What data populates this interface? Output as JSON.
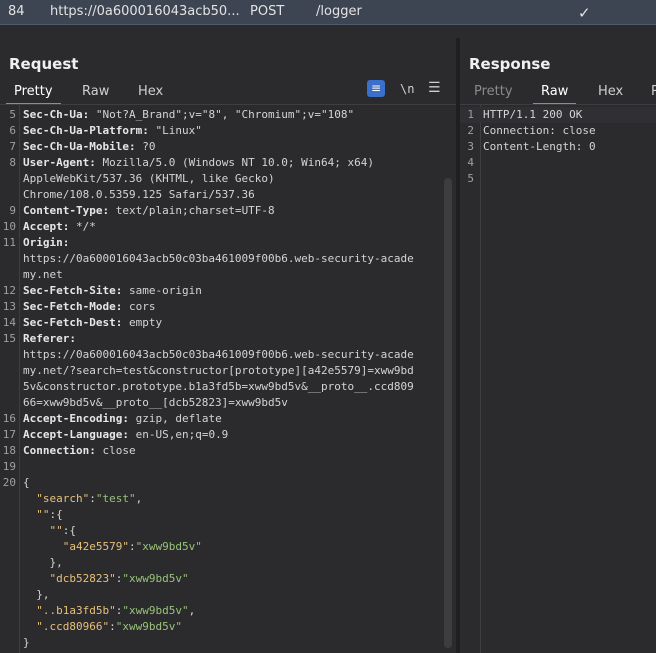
{
  "history": {
    "id": "84",
    "url": "https://0a600016043acb50...",
    "method": "POST",
    "path": "/logger",
    "status_check": "✓"
  },
  "request": {
    "title": "Request",
    "tabs": [
      "Pretty",
      "Raw",
      "Hex"
    ],
    "active_tab": "Pretty",
    "tools": {
      "wrap_icon": "wrap-lines-icon",
      "newline_label": "\\n",
      "menu_icon": "hamburger-menu-icon"
    },
    "lines": [
      {
        "n": "5",
        "name": "Sec-Ch-Ua",
        "value": "\"Not?A_Brand\";v=\"8\", \"Chromium\";v=\"108\""
      },
      {
        "n": "6",
        "name": "Sec-Ch-Ua-Platform",
        "value": "\"Linux\""
      },
      {
        "n": "7",
        "name": "Sec-Ch-Ua-Mobile",
        "value": "?0"
      },
      {
        "n": "8",
        "name": "User-Agent",
        "value": "Mozilla/5.0 (Windows NT 10.0; Win64; x64)"
      },
      {
        "n": "",
        "name": "",
        "value": "AppleWebKit/537.36 (KHTML, like Gecko)"
      },
      {
        "n": "",
        "name": "",
        "value": "Chrome/108.0.5359.125 Safari/537.36"
      },
      {
        "n": "9",
        "name": "Content-Type",
        "value": "text/plain;charset=UTF-8"
      },
      {
        "n": "10",
        "name": "Accept",
        "value": "*/*"
      },
      {
        "n": "11",
        "name": "Origin",
        "value": ""
      },
      {
        "n": "",
        "name": "",
        "value": "https://0a600016043acb50c03ba461009f00b6.web-security-acade"
      },
      {
        "n": "",
        "name": "",
        "value": "my.net"
      },
      {
        "n": "12",
        "name": "Sec-Fetch-Site",
        "value": "same-origin"
      },
      {
        "n": "13",
        "name": "Sec-Fetch-Mode",
        "value": "cors"
      },
      {
        "n": "14",
        "name": "Sec-Fetch-Dest",
        "value": "empty"
      },
      {
        "n": "15",
        "name": "Referer",
        "value": ""
      },
      {
        "n": "",
        "name": "",
        "value": "https://0a600016043acb50c03ba461009f00b6.web-security-acade"
      },
      {
        "n": "",
        "name": "",
        "value": "my.net/?search=test&constructor[prototype][a42e5579]=xww9bd"
      },
      {
        "n": "",
        "name": "",
        "value": "5v&constructor.prototype.b1a3fd5b=xww9bd5v&__proto__.ccd809"
      },
      {
        "n": "",
        "name": "",
        "value": "66=xww9bd5v&__proto__[dcb52823]=xww9bd5v"
      },
      {
        "n": "16",
        "name": "Accept-Encoding",
        "value": "gzip, deflate"
      },
      {
        "n": "17",
        "name": "Accept-Language",
        "value": "en-US,en;q=0.9"
      },
      {
        "n": "18",
        "name": "Connection",
        "value": "close"
      },
      {
        "n": "19",
        "name": "",
        "value": ""
      },
      {
        "n": "20",
        "name": "",
        "value": "{"
      },
      {
        "n": "",
        "key": "\"search\"",
        "sep": ":",
        "jval": "\"test\"",
        "tail": ",",
        "indent": "  "
      },
      {
        "n": "",
        "key": "\"\"",
        "sep": ":{",
        "jval": "",
        "tail": "",
        "indent": "  "
      },
      {
        "n": "",
        "key": "\"\"",
        "sep": ":{",
        "jval": "",
        "tail": "",
        "indent": "    "
      },
      {
        "n": "",
        "key": "\"a42e5579\"",
        "sep": ":",
        "jval": "\"xww9bd5v\"",
        "tail": "",
        "indent": "      "
      },
      {
        "n": "",
        "name": "",
        "value": "    },"
      },
      {
        "n": "",
        "key": "\"dcb52823\"",
        "sep": ":",
        "jval": "\"xww9bd5v\"",
        "tail": "",
        "indent": "    "
      },
      {
        "n": "",
        "name": "",
        "value": "  },"
      },
      {
        "n": "",
        "key": "\"..b1a3fd5b\"",
        "sep": ":",
        "jval": "\"xww9bd5v\"",
        "tail": ",",
        "indent": "  "
      },
      {
        "n": "",
        "key": "\".ccd80966\"",
        "sep": ":",
        "jval": "\"xww9bd5v\"",
        "tail": "",
        "indent": "  "
      },
      {
        "n": "",
        "name": "",
        "value": "}"
      }
    ]
  },
  "response": {
    "title": "Response",
    "tabs": [
      "Pretty",
      "Raw",
      "Hex",
      "R"
    ],
    "active_tab": "Raw",
    "lines": [
      {
        "n": "1",
        "value": "HTTP/1.1 200 OK"
      },
      {
        "n": "2",
        "value": "Connection: close"
      },
      {
        "n": "3",
        "value": "Content-Length: 0"
      },
      {
        "n": "4",
        "value": ""
      },
      {
        "n": "5",
        "value": ""
      }
    ]
  },
  "colors": {
    "accent_tab": "#e8712f",
    "wrap_button": "#3b6fc9",
    "json_key": "#e6c07b",
    "json_value": "#98c379"
  }
}
